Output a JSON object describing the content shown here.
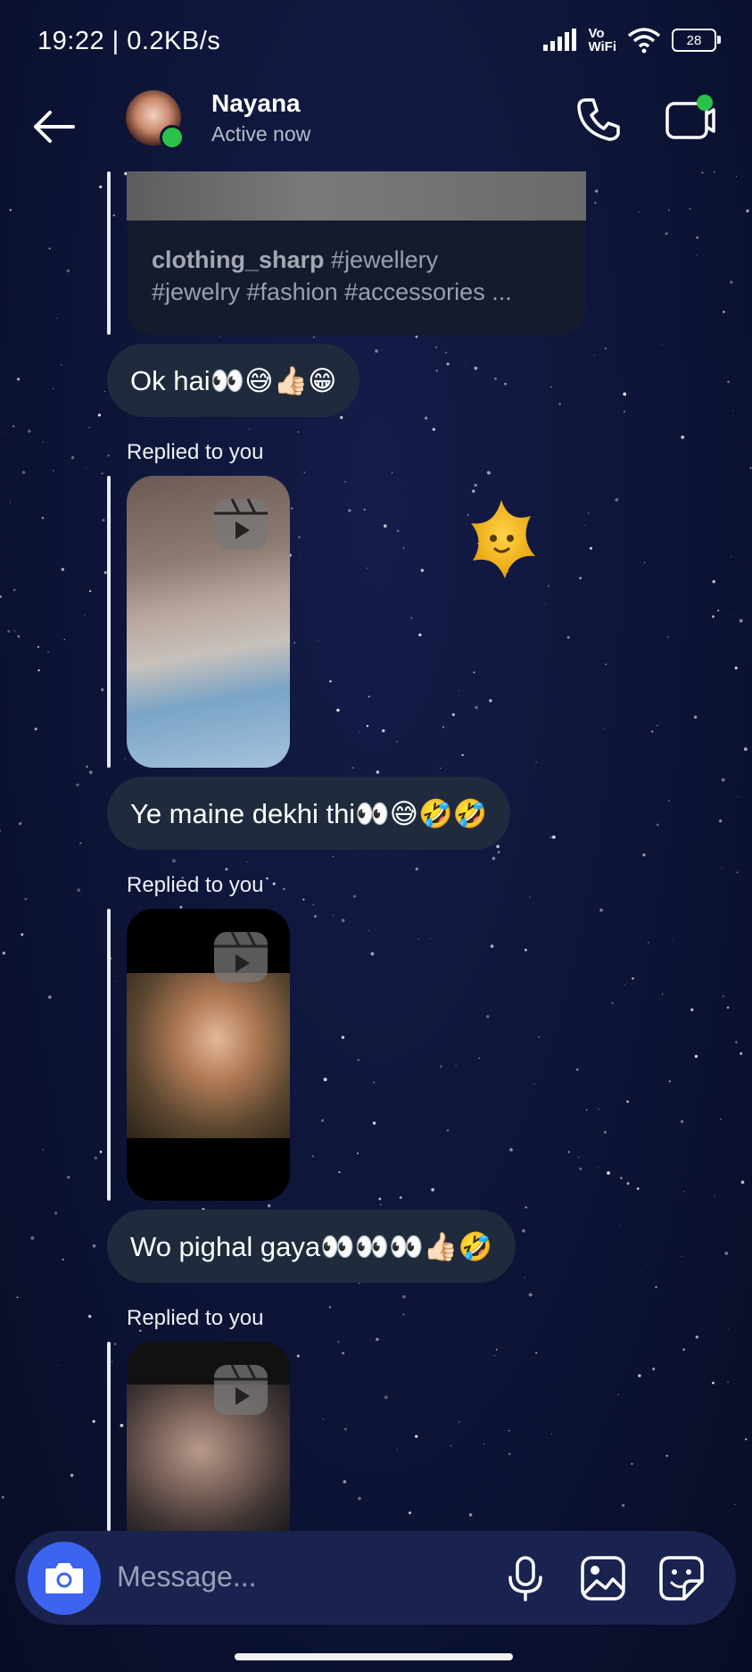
{
  "status_bar": {
    "time": "19:22 | 0.2KB/s",
    "vowifi_top": "Vo",
    "vowifi_bottom": "WiFi",
    "battery": "28"
  },
  "header": {
    "name": "Nayana",
    "status": "Active now"
  },
  "shared_post": {
    "username": "clothing_sharp",
    "caption_line1": "#jewellery",
    "caption_line2": "#jewelry #fashion #accessories ..."
  },
  "messages": [
    {
      "text": "Ok hai👀😅👍🏻😁"
    },
    {
      "replied": "Replied to you",
      "text": "Ye maine dekhi thi👀😅🤣🤣"
    },
    {
      "replied": "Replied to you",
      "text": "Wo pighal gaya👀👀👀👍🏻🤣"
    },
    {
      "replied": "Replied to you"
    }
  ],
  "composer": {
    "placeholder": "Message..."
  },
  "colors": {
    "accent": "#3c64f0",
    "online": "#2bc24b",
    "bubble": "#1f2b3d"
  }
}
